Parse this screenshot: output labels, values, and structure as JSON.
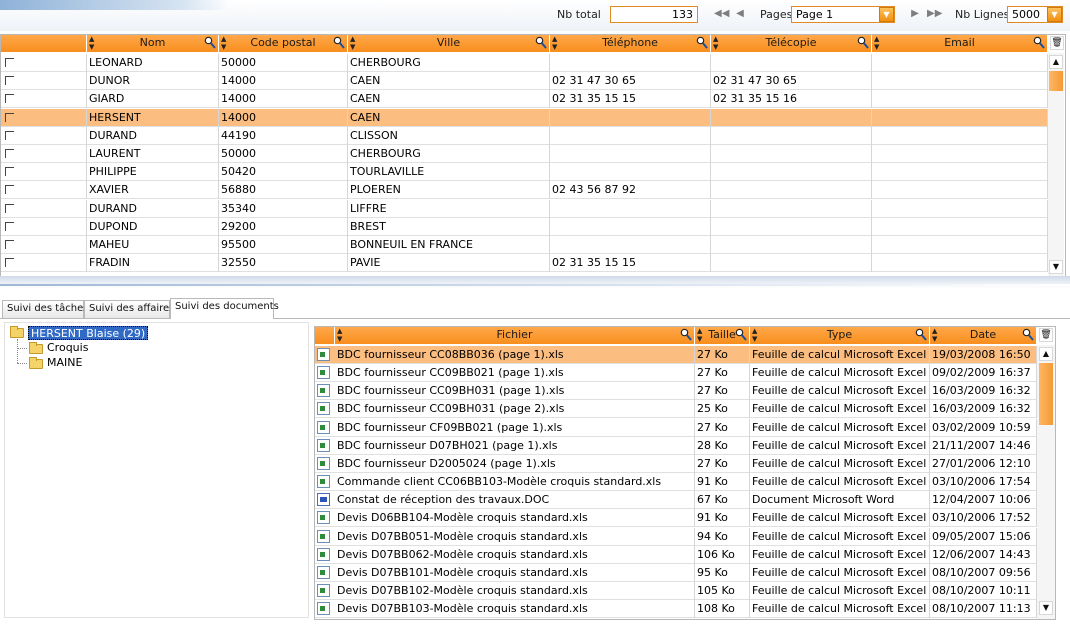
{
  "toolbar": {
    "nb_total_label": "Nb total",
    "nb_total_value": "133",
    "pages_label": "Pages",
    "page_select": "Page 1",
    "nb_lignes_label": "Nb Lignes",
    "nb_lignes_value": "5000"
  },
  "contacts": {
    "columns": [
      "Nom",
      "Code postal",
      "Ville",
      "Téléphone",
      "Télécopie",
      "Email"
    ],
    "selected_index": 3,
    "rows": [
      [
        "LEONARD",
        "50000",
        "CHERBOURG",
        "",
        "",
        ""
      ],
      [
        "DUNOR",
        "14000",
        "CAEN",
        "02 31 47 30 65",
        "02 31 47 30 65",
        ""
      ],
      [
        "GIARD",
        "14000",
        "CAEN",
        "02 31 35 15 15",
        "02 31 35 15 16",
        ""
      ],
      [
        "HERSENT",
        "14000",
        "CAEN",
        "",
        "",
        ""
      ],
      [
        "DURAND",
        "44190",
        "CLISSON",
        "",
        "",
        ""
      ],
      [
        "LAURENT",
        "50000",
        "CHERBOURG",
        "",
        "",
        ""
      ],
      [
        "PHILIPPE",
        "50420",
        "TOURLAVILLE",
        "",
        "",
        ""
      ],
      [
        "XAVIER",
        "56880",
        "PLOEREN",
        "02 43 56 87 92",
        "",
        ""
      ],
      [
        "DURAND",
        "35340",
        "LIFFRE",
        "",
        "",
        ""
      ],
      [
        "DUPOND",
        "29200",
        "BREST",
        "",
        "",
        ""
      ],
      [
        "MAHEU",
        "95500",
        "BONNEUIL EN FRANCE",
        "",
        "",
        ""
      ],
      [
        "FRADIN",
        "32550",
        "PAVIE",
        "02 31 35 15 15",
        "",
        ""
      ]
    ]
  },
  "tabs": [
    "Suivi des tâches",
    "Suivi des affaires",
    "Suivi des documents"
  ],
  "active_tab": 2,
  "tree": {
    "root": "HERSENT Blaise (29)",
    "children": [
      "Croquis",
      "MAINE"
    ]
  },
  "documents": {
    "columns": [
      "Fichier",
      "Taille",
      "Type",
      "Date"
    ],
    "selected_index": 0,
    "rows": [
      {
        "icon": "excel-file-icon",
        "name": "BDC fournisseur CC08BB036 (page 1).xls",
        "size": "27 Ko",
        "type": "Feuille de calcul Microsoft Excel",
        "date": "19/03/2008 16:50"
      },
      {
        "icon": "excel-file-icon",
        "name": "BDC fournisseur CC09BB021 (page 1).xls",
        "size": "27 Ko",
        "type": "Feuille de calcul Microsoft Excel",
        "date": "09/02/2009 16:37"
      },
      {
        "icon": "excel-file-icon",
        "name": "BDC fournisseur CC09BH031 (page 1).xls",
        "size": "27 Ko",
        "type": "Feuille de calcul Microsoft Excel",
        "date": "16/03/2009 16:32"
      },
      {
        "icon": "excel-file-icon",
        "name": "BDC fournisseur CC09BH031 (page 2).xls",
        "size": "25 Ko",
        "type": "Feuille de calcul Microsoft Excel",
        "date": "16/03/2009 16:32"
      },
      {
        "icon": "excel-file-icon",
        "name": "BDC fournisseur CF09BB021 (page 1).xls",
        "size": "27 Ko",
        "type": "Feuille de calcul Microsoft Excel",
        "date": "03/02/2009 10:59"
      },
      {
        "icon": "excel-file-icon",
        "name": "BDC fournisseur D07BH021 (page 1).xls",
        "size": "28 Ko",
        "type": "Feuille de calcul Microsoft Excel",
        "date": "21/11/2007 14:46"
      },
      {
        "icon": "excel-file-icon",
        "name": "BDC fournisseur D2005024 (page 1).xls",
        "size": "27 Ko",
        "type": "Feuille de calcul Microsoft Excel",
        "date": "27/01/2006 12:10"
      },
      {
        "icon": "excel-file-icon",
        "name": "Commande client CC06BB103-Modèle croquis standard.xls",
        "size": "91 Ko",
        "type": "Feuille de calcul Microsoft Excel",
        "date": "03/10/2006 17:54"
      },
      {
        "icon": "word-file-icon",
        "name": "Constat de réception des travaux.DOC",
        "size": "67 Ko",
        "type": "Document Microsoft Word",
        "date": "12/04/2007 10:06"
      },
      {
        "icon": "excel-file-icon",
        "name": "Devis D06BB104-Modèle croquis standard.xls",
        "size": "91 Ko",
        "type": "Feuille de calcul Microsoft Excel",
        "date": "03/10/2006 17:52"
      },
      {
        "icon": "excel-file-icon",
        "name": "Devis D07BB051-Modèle croquis standard.xls",
        "size": "94 Ko",
        "type": "Feuille de calcul Microsoft Excel",
        "date": "09/05/2007 15:06"
      },
      {
        "icon": "excel-file-icon",
        "name": "Devis D07BB062-Modèle croquis standard.xls",
        "size": "106 Ko",
        "type": "Feuille de calcul Microsoft Excel",
        "date": "12/06/2007 14:43"
      },
      {
        "icon": "excel-file-icon",
        "name": "Devis D07BB101-Modèle croquis standard.xls",
        "size": "95 Ko",
        "type": "Feuille de calcul Microsoft Excel",
        "date": "08/10/2007 09:56"
      },
      {
        "icon": "excel-file-icon",
        "name": "Devis D07BB102-Modèle croquis standard.xls",
        "size": "105 Ko",
        "type": "Feuille de calcul Microsoft Excel",
        "date": "08/10/2007 10:11"
      },
      {
        "icon": "excel-file-icon",
        "name": "Devis D07BB103-Modèle croquis standard.xls",
        "size": "108 Ko",
        "type": "Feuille de calcul Microsoft Excel",
        "date": "08/10/2007 11:13"
      }
    ]
  },
  "colors": {
    "accent_orange": "#f88e1d",
    "selection_row": "#fbbd80",
    "tree_selection": "#316ac5"
  }
}
